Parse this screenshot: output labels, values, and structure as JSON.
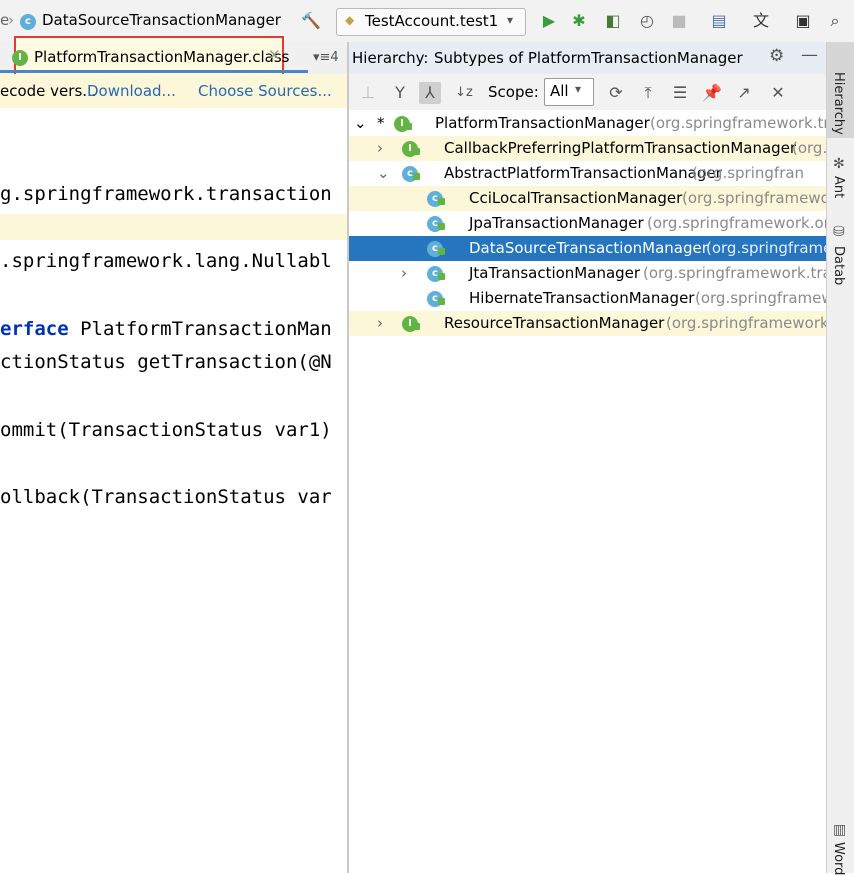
{
  "toolbar": {
    "breadcrumb_prefix": "e",
    "breadcrumb_sep": "›",
    "breadcrumb_file": "DataSourceTransactionManager",
    "run_config": "TestAccount.test1",
    "icons": [
      "hammer-icon",
      "run-icon",
      "debug-icon",
      "coverage-icon",
      "profile-icon",
      "stop-icon",
      "project-structure-icon",
      "translate-icon",
      "presentation-icon",
      "search-icon"
    ]
  },
  "editor_tabs": {
    "active_tab": "PlatformTransactionManager.class",
    "tab_count": "4"
  },
  "notification": {
    "text": "ecode vers...",
    "download_link": "Download...",
    "sources_link": "Choose Sources..."
  },
  "code": {
    "line1": "g.springframework.transaction",
    "line2": ".springframework.lang.Nullabl",
    "line3_kw": "erface",
    "line3_rest": " PlatformTransactionMan",
    "line4": "ctionStatus getTransaction(@N",
    "line5": "ommit(TransactionStatus var1)",
    "line6": "ollback(TransactionStatus var"
  },
  "hierarchy": {
    "title": "Hierarchy:",
    "subtitle": "Subtypes of PlatformTransactionManager",
    "scope_label": "Scope:",
    "scope_value": "All",
    "rows": [
      {
        "name": "PlatformTransactionManager",
        "pkg": "(org.springframework.tr",
        "kind": "I",
        "arrow": "*"
      },
      {
        "name": "CallbackPreferringPlatformTransactionManager",
        "pkg": "(org.",
        "kind": "I",
        "arrow": ">"
      },
      {
        "name": "AbstractPlatformTransactionManager",
        "pkg": "(org.springfran",
        "kind": "C",
        "arrow": "v"
      },
      {
        "name": "CciLocalTransactionManager",
        "pkg": "(org.springframewo",
        "kind": "C",
        "arrow": ""
      },
      {
        "name": "JpaTransactionManager",
        "pkg": "(org.springframework.or",
        "kind": "C",
        "arrow": ""
      },
      {
        "name": "DataSourceTransactionManager",
        "pkg": "(org.springframe",
        "kind": "C",
        "arrow": ""
      },
      {
        "name": "JtaTransactionManager",
        "pkg": "(org.springframework.tra",
        "kind": "C",
        "arrow": ">"
      },
      {
        "name": "HibernateTransactionManager",
        "pkg": "(org.springframework",
        "kind": "C",
        "arrow": ""
      },
      {
        "name": "ResourceTransactionManager",
        "pkg": "(org.springframework.",
        "kind": "I",
        "arrow": ">"
      }
    ]
  },
  "side_strip": {
    "hierarchy": "Hierarchy",
    "ant": "Ant",
    "database": "Datab",
    "word": "Word"
  },
  "colors": {
    "selection": "#2675bf",
    "highlight": "#fcf7d9",
    "tab_outline": "#e53935",
    "class_badge": "#5fb0d8",
    "interface_badge": "#62b543"
  }
}
